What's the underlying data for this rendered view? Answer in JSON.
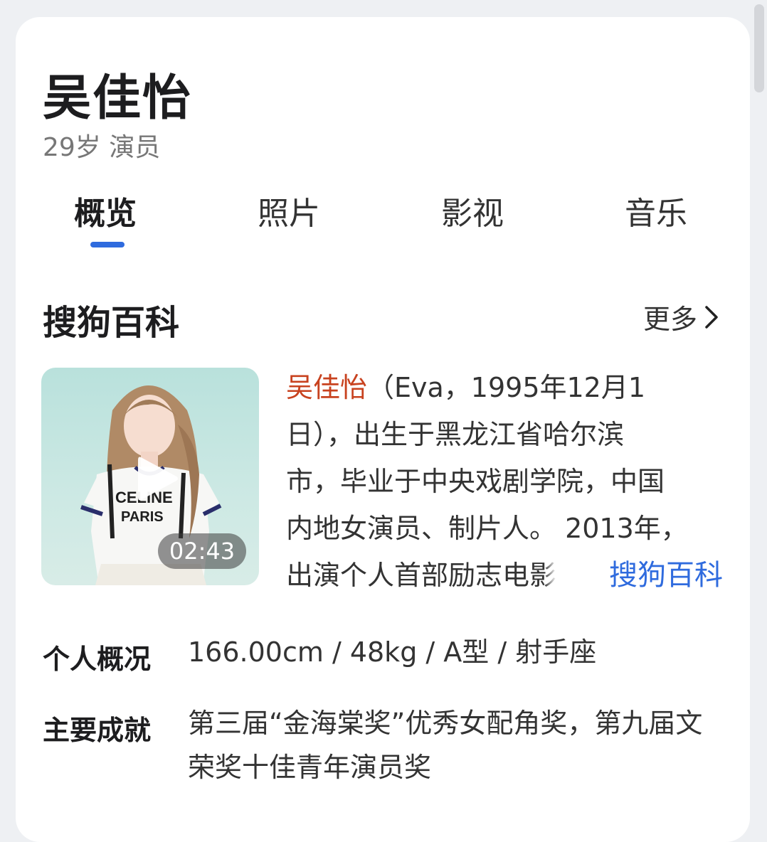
{
  "profile": {
    "name": "吴佳怡",
    "subtitle": "29岁 演员"
  },
  "tabs": [
    {
      "label": "概览",
      "active": true
    },
    {
      "label": "照片",
      "active": false
    },
    {
      "label": "影视",
      "active": false
    },
    {
      "label": "音乐",
      "active": false
    }
  ],
  "section": {
    "title": "搜狗百科",
    "more_label": "更多"
  },
  "video": {
    "duration": "02:43",
    "overlay_text": "CELINE PARIS"
  },
  "summary": {
    "highlight_name": "吴佳怡",
    "line1_rest": "（Eva，1995年12月1",
    "line2": "日），出生于黑龙江省哈尔滨",
    "line3": "市，毕业于中央戏剧学院，中国",
    "line4": "内地女演员、制片人。 2013年，",
    "line5": "出演个人首部励志电",
    "line5_fade": "影",
    "source_link": "搜狗百科"
  },
  "info": [
    {
      "label": "个人概况",
      "value": "166.00cm / 48kg / A型 / 射手座"
    },
    {
      "label": "主要成就",
      "value": "第三届“金海棠奖”优秀女配角奖，第九届文荣奖十佳青年演员奖"
    }
  ],
  "colors": {
    "accent": "#2f6bde",
    "highlight": "#c8421f",
    "background": "#eef0f3"
  }
}
